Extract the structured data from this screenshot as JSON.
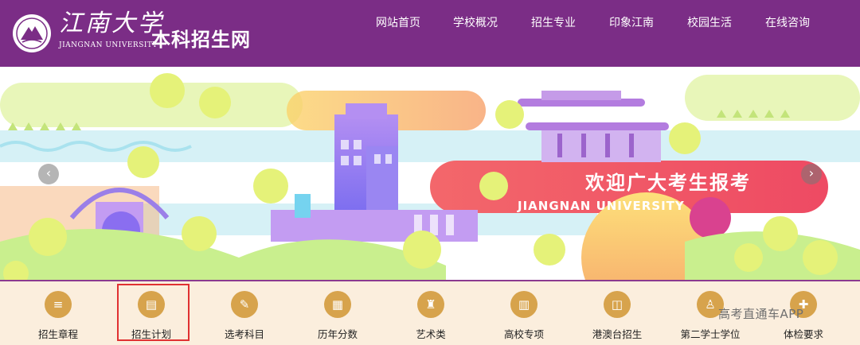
{
  "header": {
    "logo_cn": "江南大学",
    "logo_en": "JIANGNAN UNIVERSITY",
    "site_title": "本科招生网",
    "nav": [
      "网站首页",
      "学校概况",
      "招生专业",
      "印象江南",
      "校园生活",
      "在线咨询"
    ]
  },
  "banner": {
    "title": "欢迎广大考生报考",
    "subtitle": "JIANGNAN UNIVERSITY",
    "prev_arrow": "‹",
    "next_arrow": "›"
  },
  "quick_links": [
    {
      "label": "招生章程",
      "icon": "document-icon",
      "glyph": "≡"
    },
    {
      "label": "招生计划",
      "icon": "plan-icon",
      "glyph": "▤",
      "selected": true
    },
    {
      "label": "选考科目",
      "icon": "edit-icon",
      "glyph": "✎"
    },
    {
      "label": "历年分数",
      "icon": "calendar-icon",
      "glyph": "▦"
    },
    {
      "label": "艺术类",
      "icon": "art-icon",
      "glyph": "♜"
    },
    {
      "label": "高校专项",
      "icon": "building-icon",
      "glyph": "▥"
    },
    {
      "label": "港澳台招生",
      "icon": "id-card-icon",
      "glyph": "◫"
    },
    {
      "label": "第二学士学位",
      "icon": "user-icon",
      "glyph": "♙"
    },
    {
      "label": "体检要求",
      "icon": "health-icon",
      "glyph": "✚"
    }
  ],
  "watermark": "高考直通车APP",
  "colors": {
    "header_bg": "#7b2d86",
    "quickbar_bg": "#fbeedd",
    "icon_bg": "#d7a34c",
    "highlight": "#e03131"
  }
}
